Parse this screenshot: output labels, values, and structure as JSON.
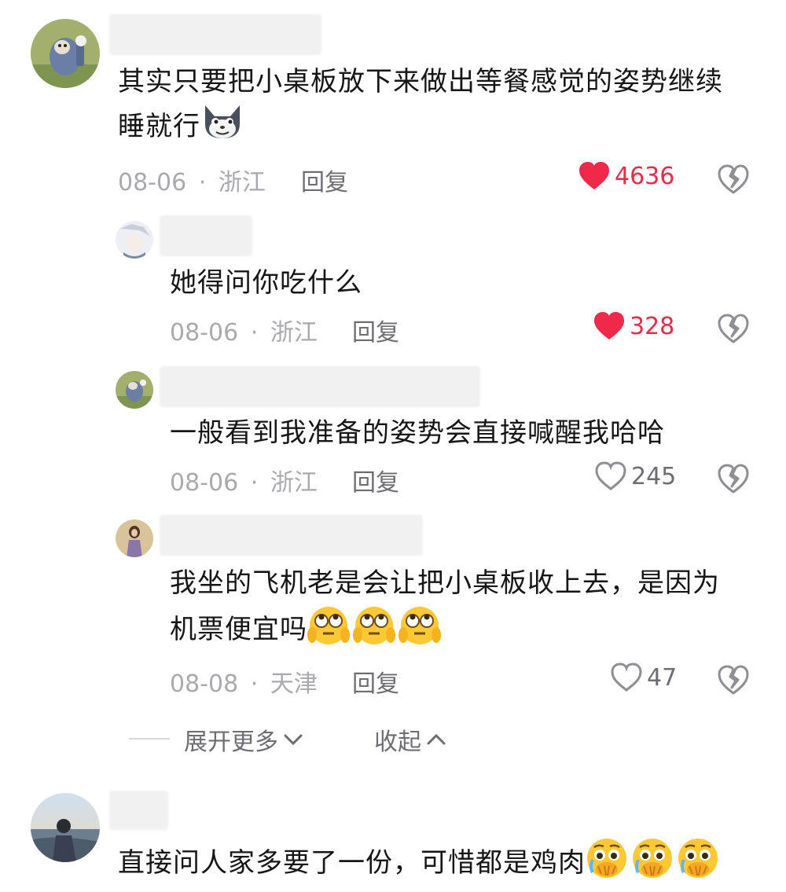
{
  "comments": [
    {
      "text_line1": "其实只要把小桌板放下来做出等餐感觉的姿势继续",
      "text_line2": "睡就行",
      "emoji": "wolf-grin-emoji",
      "date": "08-06",
      "location": "浙江",
      "reply_label": "回复",
      "likes": "4636",
      "liked": true
    },
    {
      "text": "她得问你吃什么",
      "date": "08-06",
      "location": "浙江",
      "reply_label": "回复",
      "likes": "328",
      "liked": true
    },
    {
      "text": "一般看到我准备的姿势会直接喊醒我哈哈",
      "date": "08-06",
      "location": "浙江",
      "reply_label": "回复",
      "likes": "245",
      "liked": false
    },
    {
      "text_line1": "我坐的飞机老是会让把小桌板收上去，是因为",
      "text_line2": "机票便宜吗",
      "emoji": "eye-roll-emoji",
      "date": "08-08",
      "location": "天津",
      "reply_label": "回复",
      "likes": "47",
      "liked": false
    },
    {
      "text": "直接问人家多要了一份，可惜都是鸡肉",
      "emoji": "crying-emoji"
    }
  ],
  "thread": {
    "expand_label": "展开更多",
    "collapse_label": "收起"
  },
  "separator": "·",
  "colors": {
    "like_active": "#f0284a",
    "muted": "#a9a9ae",
    "text": "#161616"
  }
}
